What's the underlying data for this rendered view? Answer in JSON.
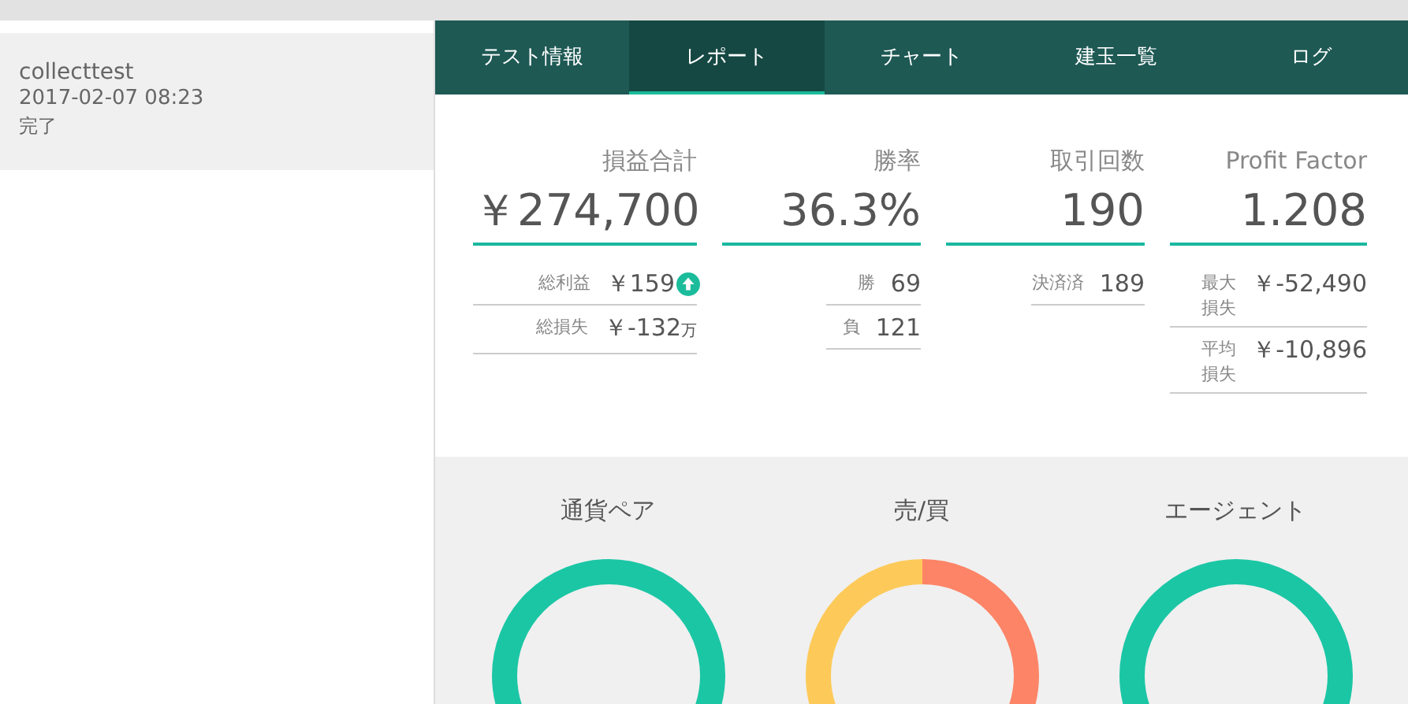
{
  "sidebar": {
    "items": [
      {
        "name": "collecttest",
        "date": "2017-02-07 08:23",
        "status": "完了",
        "selected": true
      }
    ]
  },
  "tabs": [
    {
      "label": "テスト情報",
      "selected": false
    },
    {
      "label": "レポート",
      "selected": true
    },
    {
      "label": "チャート",
      "selected": false
    },
    {
      "label": "建玉一覧",
      "selected": false
    },
    {
      "label": "ログ",
      "selected": false
    }
  ],
  "stats": [
    {
      "title": "損益合計",
      "value": "￥274,700",
      "rows": [
        {
          "label": "総利益",
          "value": "￥159",
          "unit": "",
          "badge": true
        },
        {
          "label": "総損失",
          "value": "￥-132",
          "unit": "万",
          "badge": false
        }
      ]
    },
    {
      "title": "勝率",
      "value": "36.3%",
      "rows": [
        {
          "label": "勝",
          "value": "69",
          "unit": "",
          "badge": false
        },
        {
          "label": "負",
          "value": "121",
          "unit": "",
          "badge": false
        }
      ]
    },
    {
      "title": "取引回数",
      "value": "190",
      "rows": [
        {
          "label": "決済済",
          "value": "189",
          "unit": "",
          "badge": false
        }
      ]
    },
    {
      "title": "Profit Factor",
      "value": "1.208",
      "rows": [
        {
          "label": "最大損失",
          "value": "￥-52,490",
          "unit": "",
          "badge": false
        },
        {
          "label": "平均損失",
          "value": "￥-10,896",
          "unit": "",
          "badge": false
        }
      ]
    }
  ],
  "charts": [
    {
      "title": "通貨ペア",
      "kind": "single"
    },
    {
      "title": "売/買",
      "kind": "split"
    },
    {
      "title": "エージェント",
      "kind": "single"
    }
  ]
}
